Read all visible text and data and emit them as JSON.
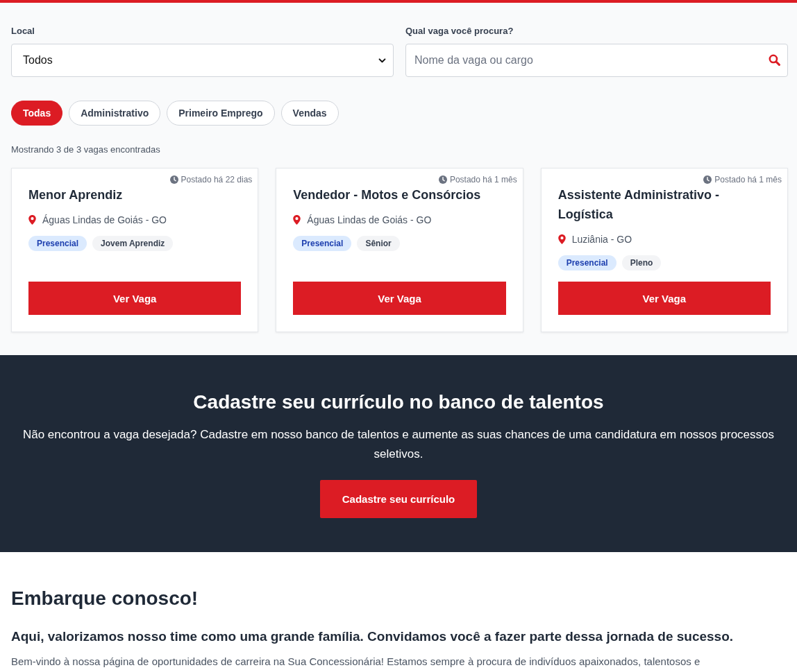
{
  "filters": {
    "location": {
      "label": "Local",
      "value": "Todos"
    },
    "search": {
      "label": "Qual vaga você procura?",
      "placeholder": "Nome da vaga ou cargo"
    }
  },
  "categories": [
    {
      "label": "Todas",
      "selected": true
    },
    {
      "label": "Administrativo",
      "selected": false
    },
    {
      "label": "Primeiro Emprego",
      "selected": false
    },
    {
      "label": "Vendas",
      "selected": false
    }
  ],
  "results_summary": "Mostrando 3 de 3 vagas encontradas",
  "jobs": [
    {
      "posted": "Postado há 22 dias",
      "title": "Menor Aprendiz",
      "location": "Águas Lindas de Goiás - GO",
      "tags": [
        {
          "label": "Presencial",
          "kind": "modality"
        },
        {
          "label": "Jovem Aprendiz",
          "kind": "level"
        }
      ],
      "button": "Ver Vaga"
    },
    {
      "posted": "Postado há 1 mês",
      "title": "Vendedor - Motos e Consórcios",
      "location": "Águas Lindas de Goiás - GO",
      "tags": [
        {
          "label": "Presencial",
          "kind": "modality"
        },
        {
          "label": "Sênior",
          "kind": "level"
        }
      ],
      "button": "Ver Vaga"
    },
    {
      "posted": "Postado há 1 mês",
      "title": "Assistente Administrativo - Logística",
      "location": "Luziânia - GO",
      "tags": [
        {
          "label": "Presencial",
          "kind": "modality"
        },
        {
          "label": "Pleno",
          "kind": "level"
        }
      ],
      "button": "Ver Vaga"
    }
  ],
  "talent_bank": {
    "title": "Cadastre seu currículo no banco de talentos",
    "text": "Não encontrou a vaga desejada? Cadastre em nosso banco de talentos e aumente as suas chances de uma candidatura em nossos processos seletivos.",
    "button": "Cadastre seu currículo"
  },
  "about": {
    "title": "Embarque conosco!",
    "subtitle": "Aqui, valorizamos nosso time como uma grande família. Convidamos você a fazer parte dessa jornada de sucesso.",
    "text": "Bem-vindo à nossa página de oportunidades de carreira na Sua Concessionária! Estamos sempre à procura de indivíduos apaixonados, talentosos e"
  }
}
